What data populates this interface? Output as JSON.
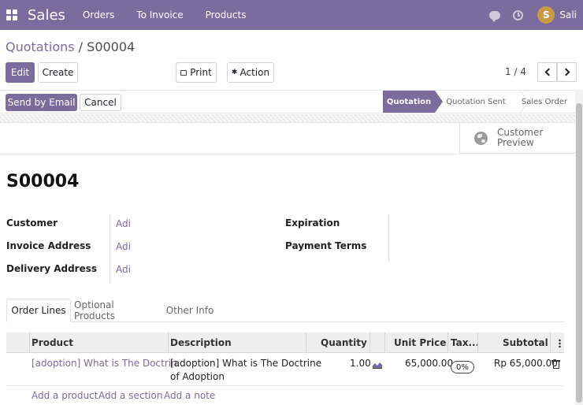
{
  "navbar": {
    "brand": "Sales",
    "menu": [
      "Orders",
      "To Invoice",
      "Products"
    ],
    "user": {
      "initial": "S",
      "name": "Sali"
    }
  },
  "breadcrumb": {
    "parent": "Quotations",
    "separator": " / ",
    "current": "S00004"
  },
  "toolbar": {
    "edit": "Edit",
    "create": "Create",
    "print": "Print",
    "action": "Action",
    "pager": "1 / 4"
  },
  "statusbar": {
    "send_email": "Send by Email",
    "cancel": "Cancel",
    "stages": [
      "Quotation",
      "Quotation Sent",
      "Sales Order"
    ],
    "active_stage": "Quotation"
  },
  "button_box": {
    "customer_preview": "Customer Preview"
  },
  "record": {
    "name": "S00004",
    "fields": {
      "customer_label": "Customer",
      "customer": "Adi",
      "invoice_label": "Invoice Address",
      "invoice": "Adi",
      "delivery_label": "Delivery Address",
      "delivery": "Adi",
      "expiration_label": "Expiration",
      "payment_label": "Payment Terms"
    }
  },
  "tabs": [
    "Order Lines",
    "Optional Products",
    "Other Info"
  ],
  "order_lines": {
    "columns": [
      "Product",
      "Description",
      "Quantity",
      "Unit Price",
      "Tax...",
      "Subtotal"
    ],
    "rows": [
      {
        "product": "[adoption] What is The Doctrin...",
        "description_1": "[adoption] What is The Doctrine",
        "description_2": "of Adoption",
        "quantity": "1.00",
        "unit_price": "65,000.00",
        "tax": "0%",
        "subtotal": "Rp 65,000.00"
      }
    ],
    "add_links": [
      "Add a product",
      "Add a section",
      "Add a note"
    ]
  },
  "colors": {
    "primary": "#7c6b9d"
  }
}
